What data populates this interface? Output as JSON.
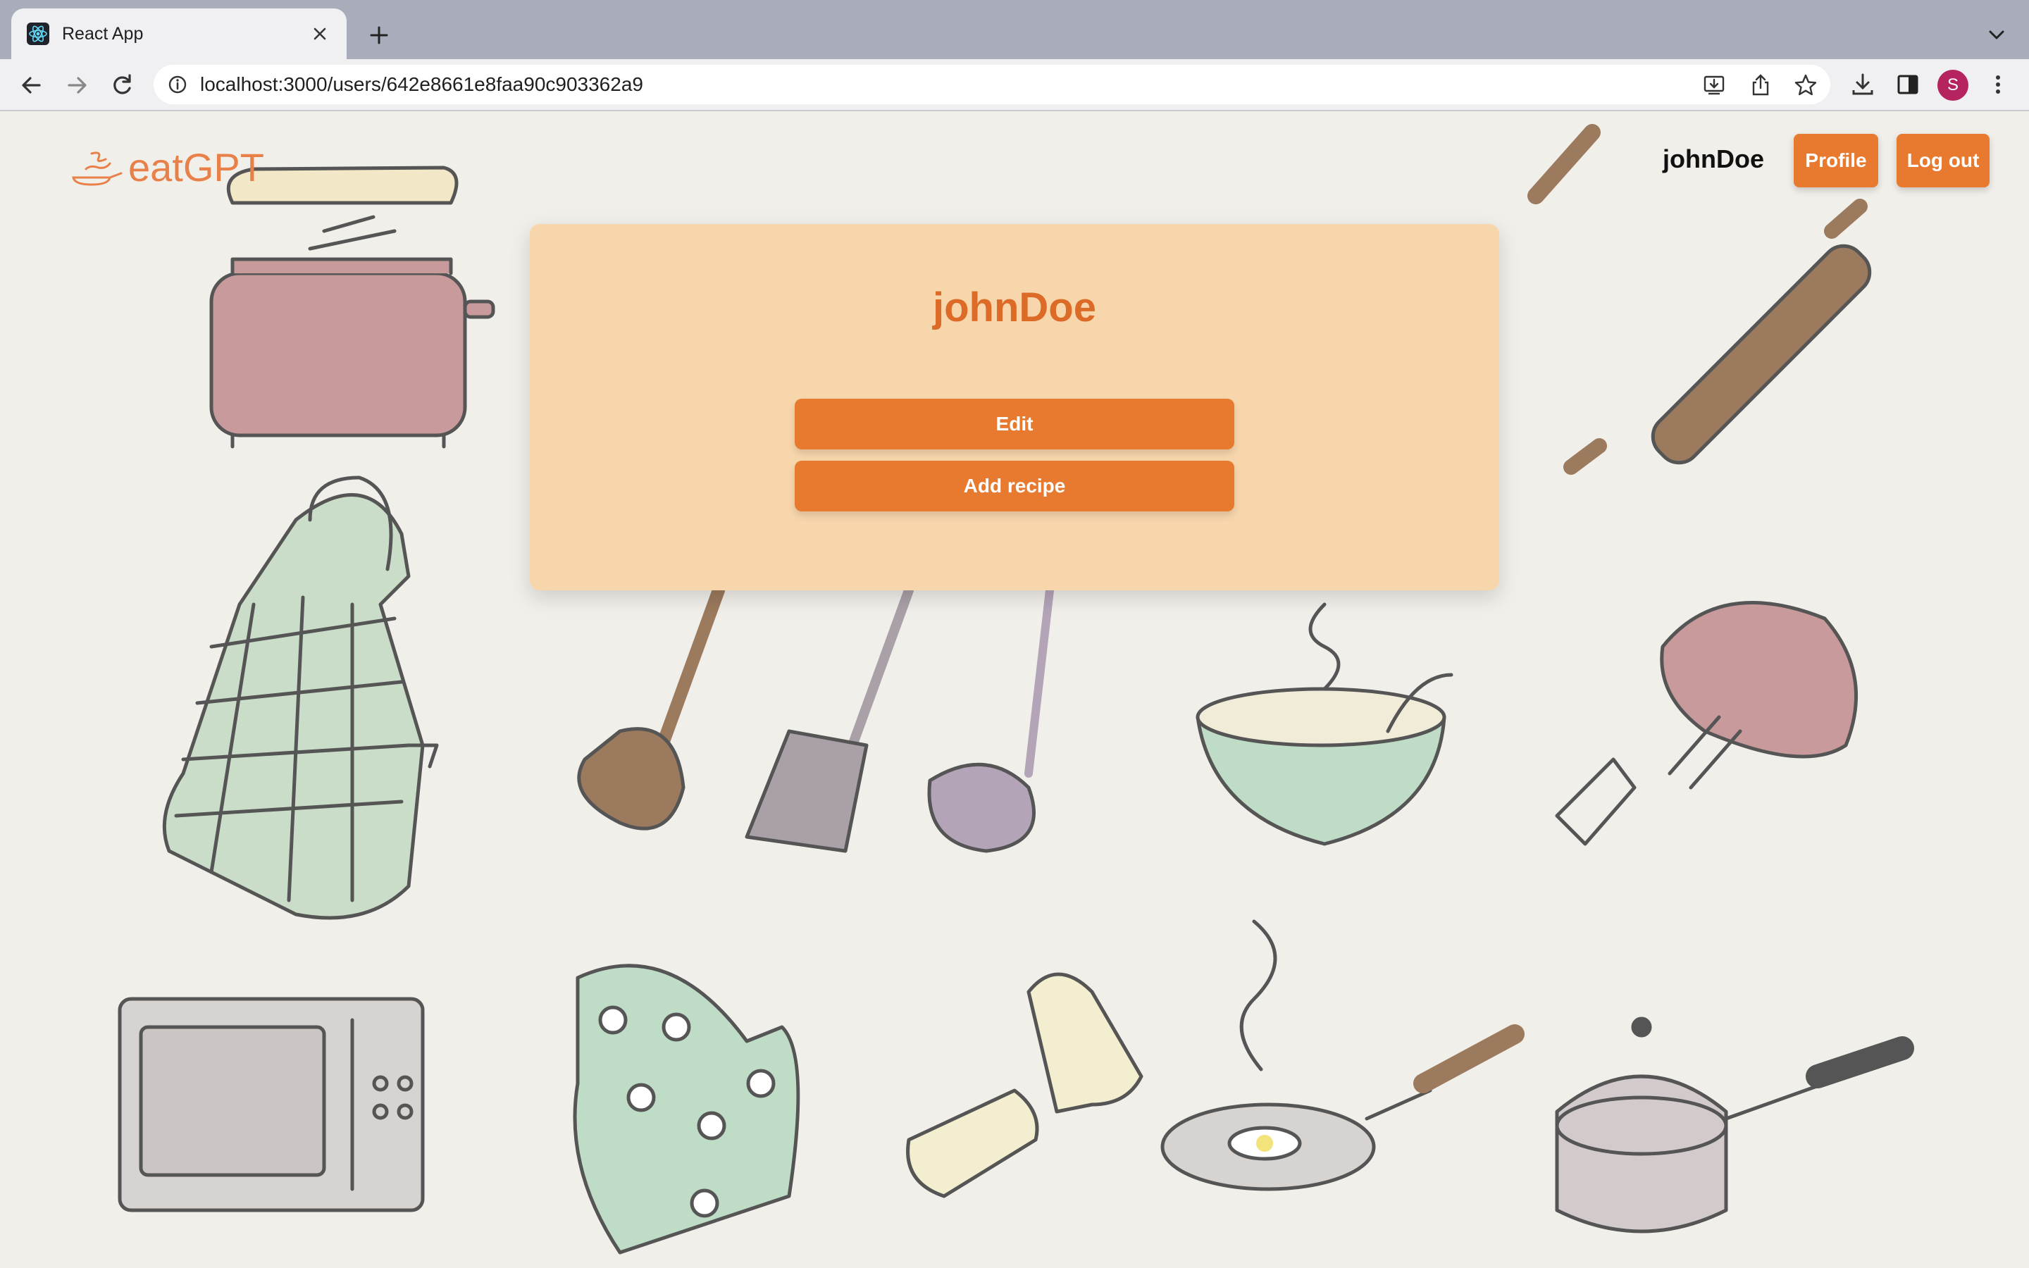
{
  "browser": {
    "tab_title": "React App",
    "url": "localhost:3000/users/642e8661e8faa90c903362a9",
    "profile_initial": "S",
    "icons": [
      "react-favicon",
      "close-icon",
      "plus-icon",
      "chevron-down-icon",
      "back-arrow-icon",
      "forward-arrow-icon",
      "reload-icon",
      "info-icon",
      "install-icon",
      "share-icon",
      "star-icon",
      "download-icon",
      "side-panel-icon",
      "more-vert-icon"
    ]
  },
  "header": {
    "logo_text": "eatGPT",
    "username": "johnDoe",
    "profile_label": "Profile",
    "logout_label": "Log out"
  },
  "card": {
    "title": "johnDoe",
    "edit_label": "Edit",
    "add_recipe_label": "Add recipe"
  },
  "colors": {
    "accent": "#e87a2f",
    "card_bg": "#f8d6ac",
    "title": "#dc6b28",
    "logo": "#e8804a",
    "page_bg": "#f1efea"
  }
}
